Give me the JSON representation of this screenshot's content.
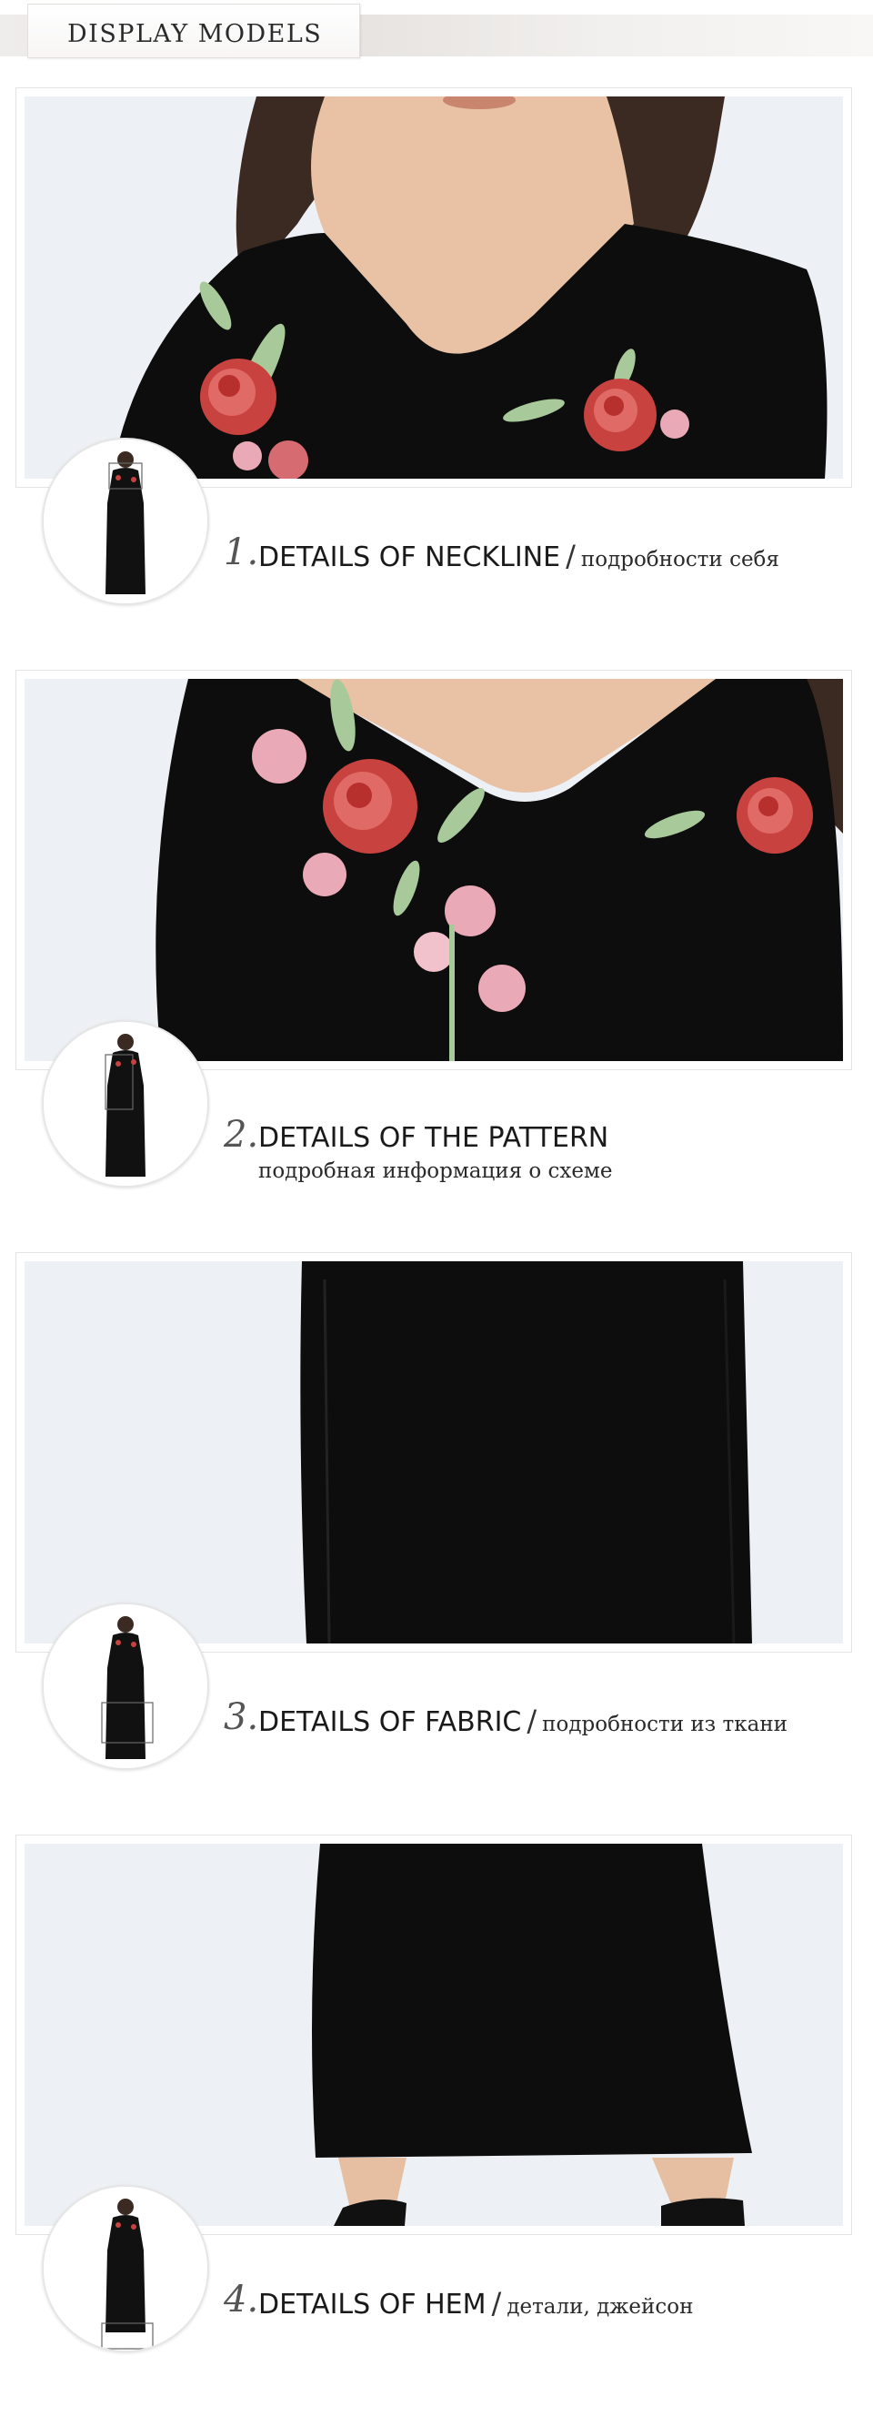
{
  "header": {
    "title": "DISPLAY MODELS"
  },
  "sections": [
    {
      "number": "1.",
      "title": "DETAILS OF NECKLINE",
      "separator": "/",
      "subtitle": "подробности себя",
      "photo": "neckline-detail",
      "thumbnail": "model-thumbnail"
    },
    {
      "number": "2.",
      "title": "DETAILS OF THE PATTERN",
      "separator": "",
      "subtitle": "подробная информация о схеме",
      "photo": "pattern-detail",
      "thumbnail": "model-thumbnail"
    },
    {
      "number": "3.",
      "title": "DETAILS OF FABRIC",
      "separator": "/",
      "subtitle": "подробности из ткани",
      "photo": "fabric-detail",
      "thumbnail": "model-thumbnail"
    },
    {
      "number": "4.",
      "title": "DETAILS OF HEM",
      "separator": "/",
      "subtitle": "детали, джейсон",
      "photo": "hem-detail",
      "thumbnail": "model-thumbnail"
    }
  ],
  "colors": {
    "dress": "#0d0d0d",
    "rose": "#c8423f",
    "rose_light": "#e9a9b6",
    "leaf": "#9fc79a",
    "backdrop": "#eceff3",
    "skin": "#e9c2a6",
    "hair": "#3a2a22"
  }
}
